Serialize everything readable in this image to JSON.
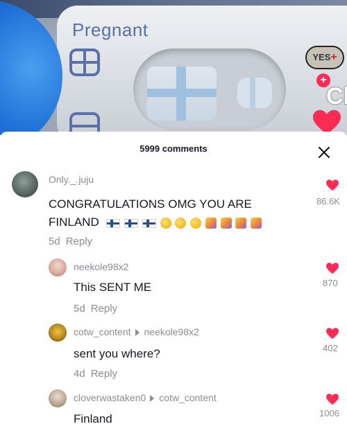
{
  "video": {
    "test_label": "Pregnant",
    "badge_text": "YES",
    "side_letter": "Cl"
  },
  "comments_header": {
    "count_label": "5999 comments"
  },
  "comments": [
    {
      "username": "Only._.juju",
      "text": "CONGRATULATIONS OMG YOU ARE FINLAND",
      "emoji_names": [
        "finland-flag",
        "finland-flag",
        "finland-flag",
        "face-with-party-horn",
        "face-with-party-horn",
        "face-with-party-horn",
        "confetti",
        "confetti",
        "confetti",
        "confetti"
      ],
      "age": "5d",
      "reply_label": "Reply",
      "likes": "86.6K"
    },
    {
      "username": "neekole98x2",
      "text": "This SENT ME",
      "age": "5d",
      "reply_label": "Reply",
      "likes": "870"
    },
    {
      "username": "cotw_content",
      "reply_to": "neekole98x2",
      "text": "sent you where?",
      "age": "4d",
      "reply_label": "Reply",
      "likes": "402"
    },
    {
      "username": "cloverwastaken0",
      "reply_to": "cotw_content",
      "text": "Finland",
      "likes": "1006"
    }
  ],
  "colors": {
    "like_red": "#fe2c55",
    "muted_text": "#8a8b91",
    "primary_text": "#161823",
    "test_ink": "#5b6fa8"
  },
  "icons": {
    "close": "close-icon",
    "like": "heart-icon",
    "reply_arrow": "triangle-right-icon"
  }
}
